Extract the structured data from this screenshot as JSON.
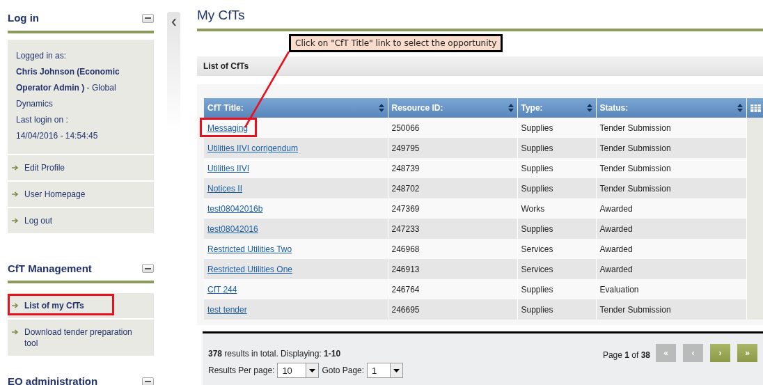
{
  "sidebar": {
    "sections": [
      {
        "title": "Log in",
        "info": [
          "Logged in as:",
          "**Chris Johnson (Economic Operator Admin )** - Global Dynamics",
          "Last login on :",
          "14/04/2016 - 14:54:45"
        ],
        "items": [
          {
            "label": "Edit Profile",
            "highlighted": false,
            "current": false
          },
          {
            "label": "User Homepage",
            "highlighted": false,
            "current": false
          },
          {
            "label": "Log out",
            "highlighted": false,
            "current": false
          }
        ]
      },
      {
        "title": "CfT Management",
        "items": [
          {
            "label": "List of my CfTs",
            "highlighted": true,
            "current": true
          },
          {
            "label": "Download tender preparation tool",
            "highlighted": false,
            "current": false
          }
        ]
      },
      {
        "title": "EO administration"
      }
    ]
  },
  "page_title": "My CfTs",
  "callout": "Click on \"CfT Title\" link to select the opportunity",
  "panel_title": "List of CfTs",
  "table": {
    "columns": [
      "CfT Title:",
      "Resource ID:",
      "Type:",
      "Status:"
    ],
    "rows": [
      {
        "title": "Messaging",
        "id": "250066",
        "type": "Supplies",
        "status": "Tender Submission",
        "highlighted": true
      },
      {
        "title": "Utilities IIVI corrigendum",
        "id": "249795",
        "type": "Supplies",
        "status": "Tender Submission",
        "highlighted": false
      },
      {
        "title": "Utilities IIVI",
        "id": "248739",
        "type": "Supplies",
        "status": "Tender Submission",
        "highlighted": false
      },
      {
        "title": "Notices II",
        "id": "248702",
        "type": "Supplies",
        "status": "Tender Submission",
        "highlighted": false
      },
      {
        "title": "test08042016b",
        "id": "247369",
        "type": "Works",
        "status": "Awarded",
        "highlighted": false
      },
      {
        "title": "test08042016",
        "id": "247233",
        "type": "Supplies",
        "status": "Awarded",
        "highlighted": false
      },
      {
        "title": "Restricted Utilities Two",
        "id": "246968",
        "type": "Services",
        "status": "Awarded",
        "highlighted": false
      },
      {
        "title": "Restricted Utilities One",
        "id": "246913",
        "type": "Services",
        "status": "Awarded",
        "highlighted": false
      },
      {
        "title": "CfT 244",
        "id": "246764",
        "type": "Supplies",
        "status": "Evaluation",
        "highlighted": false
      },
      {
        "title": "test tender",
        "id": "246695",
        "type": "Supplies",
        "status": "Tender Submission",
        "highlighted": false
      }
    ]
  },
  "footer": {
    "summary": "**378** results in total. Displaying: **1-10**",
    "per_page_label": "Results Per page:",
    "per_page": "10",
    "goto_label": "Goto Page:",
    "goto": "1",
    "page_info": "Page **1** of **38**",
    "pager": [
      {
        "label": "«",
        "disabled": true
      },
      {
        "label": "‹",
        "disabled": true
      },
      {
        "label": "›",
        "disabled": false
      },
      {
        "label": "»",
        "disabled": false
      }
    ]
  }
}
